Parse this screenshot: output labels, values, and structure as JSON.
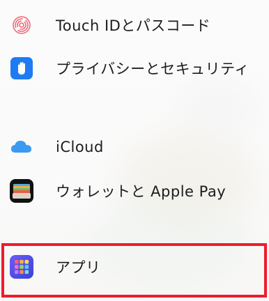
{
  "settings_list": {
    "items": [
      {
        "label": "Touch IDとパスコード",
        "icon": "fingerprint-icon"
      },
      {
        "label": "プライバシーとセキュリティ",
        "icon": "hand-icon"
      },
      {
        "label": "iCloud",
        "icon": "cloud-icon"
      },
      {
        "label": "ウォレットと Apple Pay",
        "icon": "wallet-icon"
      },
      {
        "label": "アプリ",
        "icon": "apps-grid-icon"
      }
    ]
  },
  "colors": {
    "highlight": "#ee1c2d",
    "privacy_blue": "#1f7bf2",
    "icloud_blue": "#3a9bf0"
  }
}
